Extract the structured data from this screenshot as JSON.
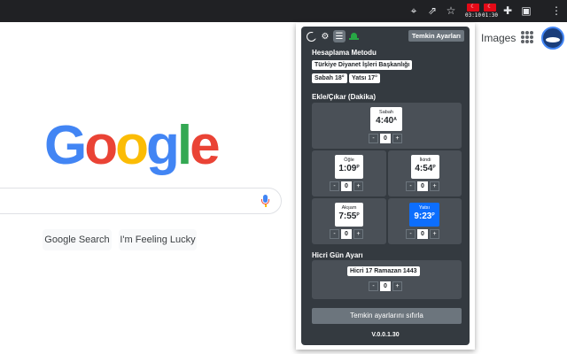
{
  "toolbar": {
    "icons": [
      "location-icon",
      "share-icon",
      "star-icon",
      "puzzle-icon",
      "sidepanel-icon",
      "more-icon"
    ],
    "extensions": [
      {
        "time": "03:10",
        "flag_color": "#e30a17"
      },
      {
        "time": "01:30",
        "flag_color": "#e30a17"
      }
    ]
  },
  "google": {
    "images_link": "Images",
    "logo_letters": [
      {
        "char": "G",
        "color": "#4285f4"
      },
      {
        "char": "o",
        "color": "#ea4335"
      },
      {
        "char": "o",
        "color": "#fbbc05"
      },
      {
        "char": "g",
        "color": "#4285f4"
      },
      {
        "char": "l",
        "color": "#34a853"
      },
      {
        "char": "e",
        "color": "#ea4335"
      }
    ],
    "search_button": "Google Search",
    "lucky_button": "I'm Feeling Lucky"
  },
  "popup": {
    "temkin_button": "Temkin Ayarları",
    "method_title": "Hesaplama Metodu",
    "method_name": "Türkiye Diyanet İşleri Başkanlığı",
    "sabah_angle": "Sabah 18°",
    "yatsi_angle": "Yatsı 17°",
    "adjust_title": "Ekle/Çıkar (Dakika)",
    "times": [
      {
        "label": "Sabah",
        "time": "4:40",
        "suffix": "A",
        "offset": "0"
      },
      {
        "label": "Öğle",
        "time": "1:09",
        "suffix": "P",
        "offset": "0"
      },
      {
        "label": "İkindi",
        "time": "4:54",
        "suffix": "P",
        "offset": "0"
      },
      {
        "label": "Akşam",
        "time": "7:55",
        "suffix": "P",
        "offset": "0"
      },
      {
        "label": "Yatsı",
        "time": "9:23",
        "suffix": "P",
        "offset": "0"
      }
    ],
    "hijri_title": "Hicri Gün Ayarı",
    "hijri_date": "Hicri 17 Ramazan 1443",
    "hijri_offset": "0",
    "minus": "-",
    "plus": "+",
    "reset_button": "Temkin ayarlarını sıfırla",
    "version": "V.0.0.1.30",
    "accent_color": "#0d6efd"
  }
}
